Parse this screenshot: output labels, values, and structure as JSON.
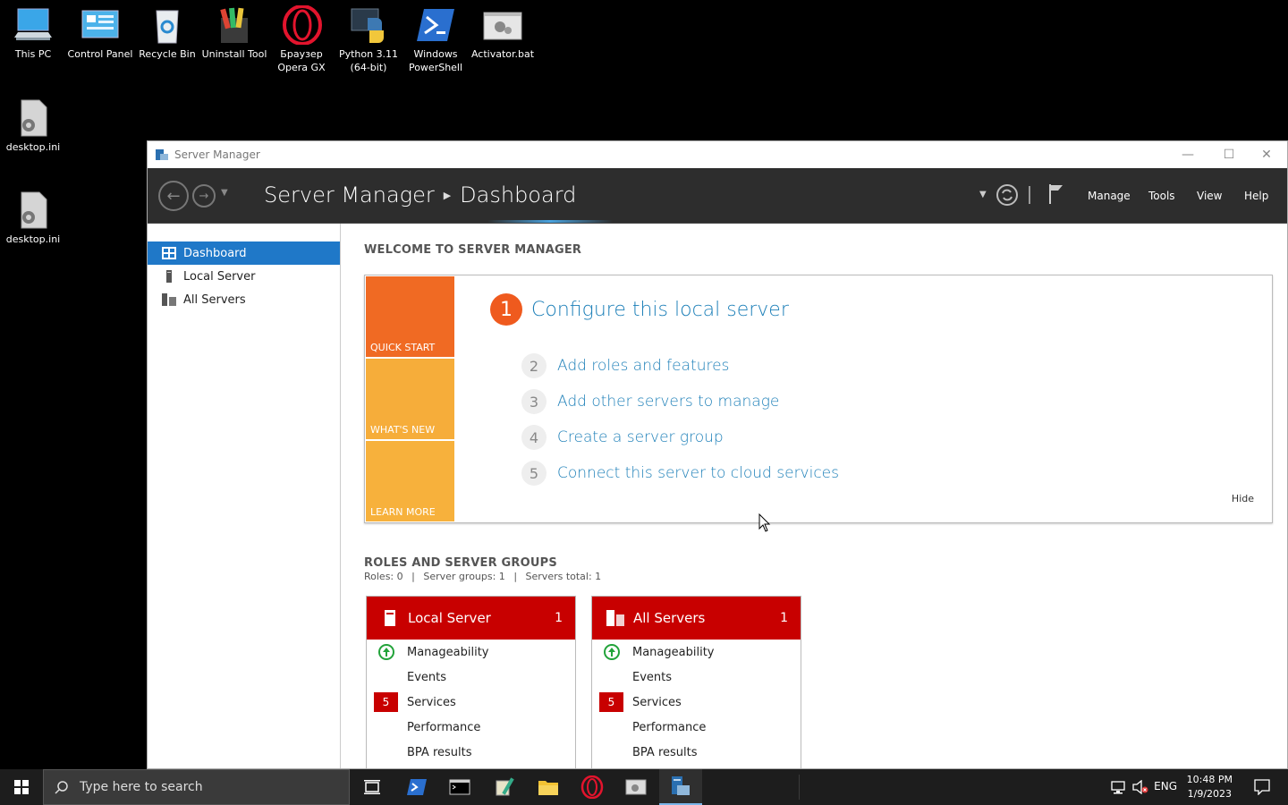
{
  "desktop": {
    "icons": [
      {
        "label": "This PC",
        "icon": "this-pc-icon"
      },
      {
        "label": "Control Panel",
        "icon": "control-panel-icon"
      },
      {
        "label": "Recycle Bin",
        "icon": "recycle-bin-icon"
      },
      {
        "label": "Uninstall Tool",
        "icon": "uninstall-tool-icon"
      },
      {
        "label": "Браузер Opera GX",
        "icon": "opera-gx-icon"
      },
      {
        "label": "Python 3.11 (64-bit)",
        "icon": "python-icon"
      },
      {
        "label": "Windows PowerShell",
        "icon": "powershell-icon"
      },
      {
        "label": "Activator.bat",
        "icon": "batch-file-icon"
      },
      {
        "label": "desktop.ini",
        "icon": "settings-file-icon"
      },
      {
        "label": "desktop.ini",
        "icon": "settings-file-icon"
      }
    ]
  },
  "window": {
    "title": "Server Manager",
    "breadcrumb": {
      "root": "Server Manager",
      "current": "Dashboard"
    },
    "menu": {
      "manage": "Manage",
      "tools": "Tools",
      "view": "View",
      "help": "Help"
    }
  },
  "sidebar": {
    "items": [
      {
        "label": "Dashboard",
        "active": true
      },
      {
        "label": "Local Server",
        "active": false
      },
      {
        "label": "All Servers",
        "active": false
      }
    ]
  },
  "welcome": {
    "title": "WELCOME TO SERVER MANAGER",
    "tiles": {
      "quick_start": "QUICK START",
      "whats_new": "WHAT'S NEW",
      "learn_more": "LEARN MORE"
    },
    "steps": [
      {
        "num": "1",
        "label": "Configure this local server"
      },
      {
        "num": "2",
        "label": "Add roles and features"
      },
      {
        "num": "3",
        "label": "Add other servers to manage"
      },
      {
        "num": "4",
        "label": "Create a server group"
      },
      {
        "num": "5",
        "label": "Connect this server to cloud services"
      }
    ],
    "hide": "Hide"
  },
  "roles": {
    "title": "ROLES AND SERVER GROUPS",
    "stats": {
      "roles": "Roles: 0",
      "groups": "Server groups: 1",
      "total": "Servers total: 1"
    },
    "cards": [
      {
        "name": "Local Server",
        "count": "1",
        "rows": [
          {
            "label": "Manageability",
            "badge": "ok"
          },
          {
            "label": "Events",
            "badge": ""
          },
          {
            "label": "Services",
            "badge": "5"
          },
          {
            "label": "Performance",
            "badge": ""
          },
          {
            "label": "BPA results",
            "badge": ""
          }
        ]
      },
      {
        "name": "All Servers",
        "count": "1",
        "rows": [
          {
            "label": "Manageability",
            "badge": "ok"
          },
          {
            "label": "Events",
            "badge": ""
          },
          {
            "label": "Services",
            "badge": "5"
          },
          {
            "label": "Performance",
            "badge": ""
          },
          {
            "label": "BPA results",
            "badge": ""
          }
        ]
      }
    ]
  },
  "taskbar": {
    "search_placeholder": "Type here to search",
    "language": "ENG",
    "time": "10:48 PM",
    "date": "1/9/2023"
  },
  "colors": {
    "accent": "#1f78c8",
    "quick_start": "#f06a23",
    "whats_new": "#f6ad3a",
    "learn_more": "#f7b13c",
    "card_header": "#c80000",
    "link": "#1c7fb8"
  }
}
